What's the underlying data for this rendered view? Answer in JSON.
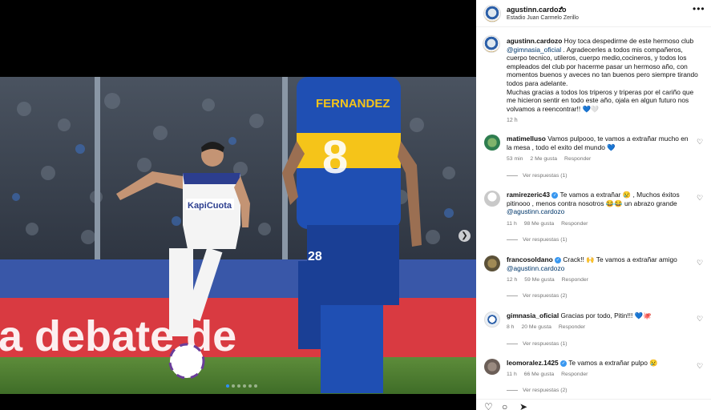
{
  "post": {
    "username": "agustinn.cardozo",
    "location": "Estadio Juan Carmelo Zerillo",
    "more_icon": "more-icon",
    "media": {
      "banner_text": "a debate de",
      "shirt_sponsor": "KapiCuota",
      "jersey_name": "FERNANDEZ",
      "jersey_number": "8",
      "other_number": "28",
      "dots": 6,
      "active_dot": 0,
      "next_icon": "chevron-right-icon"
    }
  },
  "caption": {
    "username": "agustinn.cardozo",
    "text_before": " Hoy toca despedirme de este hermoso club ",
    "mention": "@gimnasia_oficial",
    "text_after": " . Agradecerles a todos mis compañeros, cuerpo tecnico, utileros, cuerpo medio,cocineros, y todos los empleados del club por hacerme pasar un hermoso año, con momentos buenos y aveces no tan buenos pero siempre tirando todos para adelante.",
    "text_line2": "Muchas gracias a todos los triperos y triperas por el cariño que me hicieron sentir en todo este año, ojala en algun futuro nos volvamos a reencontrar!! ",
    "emoji": "💙🤍",
    "time": "12 h"
  },
  "comments": [
    {
      "username": "matimelluso",
      "verified": false,
      "text": " Vamos pulpooo, te vamos a extrañar mucho en la mesa , todo el exito del mundo 💙",
      "mention": "",
      "time": "53 min",
      "likes": "2 Me gusta",
      "reply_label": "Responder",
      "replies": "Ver respuestas (1)",
      "avatar_color": "#2e7d4f"
    },
    {
      "username": "ramirezeric43",
      "verified": true,
      "text": " Te vamos a extrañar 😢 , Muchos éxitos pitinooo , menos contra nosotros 😂😂 un abrazo grande ",
      "mention": "@agustinn.cardozo",
      "time": "11 h",
      "likes": "98 Me gusta",
      "reply_label": "Responder",
      "replies": "Ver respuestas (1)",
      "avatar_color": "#c9c9c9"
    },
    {
      "username": "francosoldano",
      "verified": true,
      "text": " Crack!! 🙌 Te vamos a extrañar amigo ",
      "mention": "@agustinn.cardozo",
      "time": "12 h",
      "likes": "59 Me gusta",
      "reply_label": "Responder",
      "replies": "Ver respuestas (2)",
      "avatar_color": "#5b5138"
    },
    {
      "username": "gimnasia_oficial",
      "verified": false,
      "text": " Gracias por todo, Pitin!!! 💙🐙",
      "mention": "",
      "time": "8 h",
      "likes": "20 Me gusta",
      "reply_label": "Responder",
      "replies": "Ver respuestas (1)",
      "avatar_color": "#e8eef5"
    },
    {
      "username": "leomoralez.1425",
      "verified": true,
      "text": " Te vamos a extrañar pulpo 😢",
      "mention": "",
      "time": "11 h",
      "likes": "66 Me gusta",
      "reply_label": "Responder",
      "replies": "Ver respuestas (2)",
      "avatar_color": "#6b5e57"
    }
  ],
  "actions": {
    "like_icon": "heart-icon",
    "comment_icon": "comment-icon",
    "share_icon": "share-icon"
  }
}
